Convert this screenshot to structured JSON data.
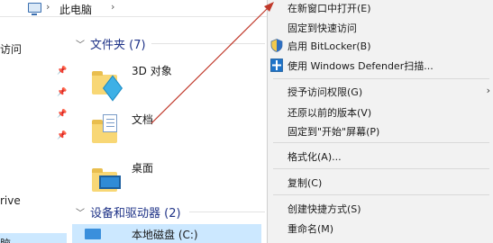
{
  "address_bar": {
    "separator_1": "›",
    "path_label": "此电脑",
    "separator_2": "›"
  },
  "nav_pane": {
    "items": [
      {
        "label": "访问",
        "pinned": false
      },
      {
        "label": "",
        "pinned": true
      },
      {
        "label": "",
        "pinned": true
      },
      {
        "label": "",
        "pinned": true
      },
      {
        "label": "",
        "pinned": true
      },
      {
        "label": "rive",
        "pinned": false
      },
      {
        "label": "脑",
        "pinned": false
      }
    ],
    "pin_glyph": "📌"
  },
  "content": {
    "folders_header": "文件夹 (7)",
    "devices_header": "设备和驱动器 (2)",
    "folders": [
      {
        "label": "3D 对象",
        "icon": "3d-objects-icon"
      },
      {
        "label": "文档",
        "icon": "documents-icon"
      },
      {
        "label": "桌面",
        "icon": "desktop-icon"
      }
    ],
    "drive_label": "本地磁盘 (C:)"
  },
  "context_menu": {
    "items": [
      {
        "label": "在新窗口中打开(E)",
        "icon": null,
        "submenu": false
      },
      {
        "label": "固定到快速访问",
        "icon": null,
        "submenu": false
      },
      {
        "label": "启用 BitLocker(B)",
        "icon": "shield-icon",
        "submenu": false
      },
      {
        "label": "使用 Windows Defender扫描...",
        "icon": "defender-icon",
        "submenu": false
      },
      {
        "label": "授予访问权限(G)",
        "icon": null,
        "submenu": true
      },
      {
        "label": "还原以前的版本(V)",
        "icon": null,
        "submenu": false
      },
      {
        "label": "固定到\"开始\"屏幕(P)",
        "icon": null,
        "submenu": false
      },
      {
        "label": "格式化(A)...",
        "icon": null,
        "submenu": false
      },
      {
        "label": "复制(C)",
        "icon": null,
        "submenu": false
      },
      {
        "label": "创建快捷方式(S)",
        "icon": null,
        "submenu": false
      },
      {
        "label": "重命名(M)",
        "icon": null,
        "submenu": false
      }
    ],
    "submenu_arrow": "›"
  },
  "colors": {
    "selection": "#cce8ff",
    "menu_bg": "#f2f2f2",
    "annotation_arrow": "#c0392b",
    "group_header": "#1e3287"
  }
}
